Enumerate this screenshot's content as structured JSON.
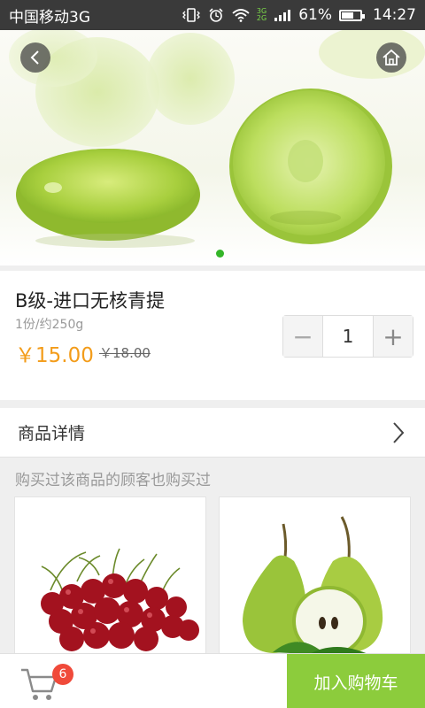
{
  "status_bar": {
    "carrier": "中国移动3G",
    "net_small_top": "3G",
    "net_small_bottom": "2G",
    "battery": "61%",
    "battery_level": 0.61,
    "time": "14:27"
  },
  "hero": {
    "carousel_index": 0,
    "carousel_count": 1
  },
  "product": {
    "title": "B级-进口无核青提",
    "spec": "1份/约250g",
    "price": "￥15.00",
    "original_price": "￥18.00",
    "quantity": "1",
    "minus_label": "−",
    "plus_label": "+"
  },
  "detail": {
    "label": "商品详情"
  },
  "also_bought": {
    "heading": "购买过该商品的顾客也购买过",
    "items": [
      {
        "icon": "cherries-image"
      },
      {
        "icon": "pears-image"
      }
    ]
  },
  "bottom_bar": {
    "cart_count": "6",
    "add_to_cart": "加入购物车"
  },
  "colors": {
    "accent_green": "#8ccc3c",
    "price_orange": "#f39c1a",
    "badge_red": "#f04a3a",
    "dot_green": "#34b528"
  }
}
